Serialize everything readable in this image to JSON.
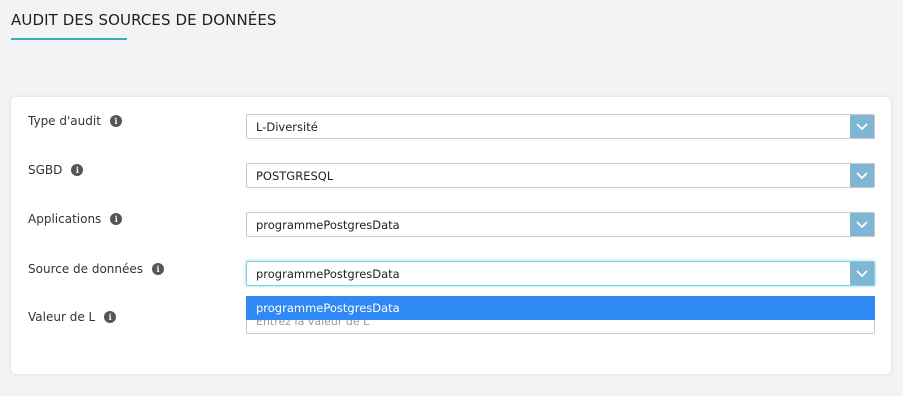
{
  "page": {
    "title": "AUDIT DES SOURCES DE DONNÉES"
  },
  "form": {
    "audit_type": {
      "label": "Type d'audit",
      "value": "L-Diversité"
    },
    "dbms": {
      "label": "SGBD",
      "value": "POSTGRESQL"
    },
    "applications": {
      "label": "Applications",
      "value": "programmePostgresData"
    },
    "data_source": {
      "label": "Source de données",
      "value": "programmePostgresData"
    },
    "l_value": {
      "label": "Valeur de L",
      "placeholder": "Entrez la valeur de L"
    },
    "dropdown_options": [
      "programmePostgresData"
    ]
  },
  "icons": {
    "info": "info-icon",
    "dropdown": "chevron-down-icon"
  },
  "colors": {
    "accent": "#3fa7c9",
    "dropdown_button": "#7fb6d3",
    "highlight": "#2f89f2"
  }
}
